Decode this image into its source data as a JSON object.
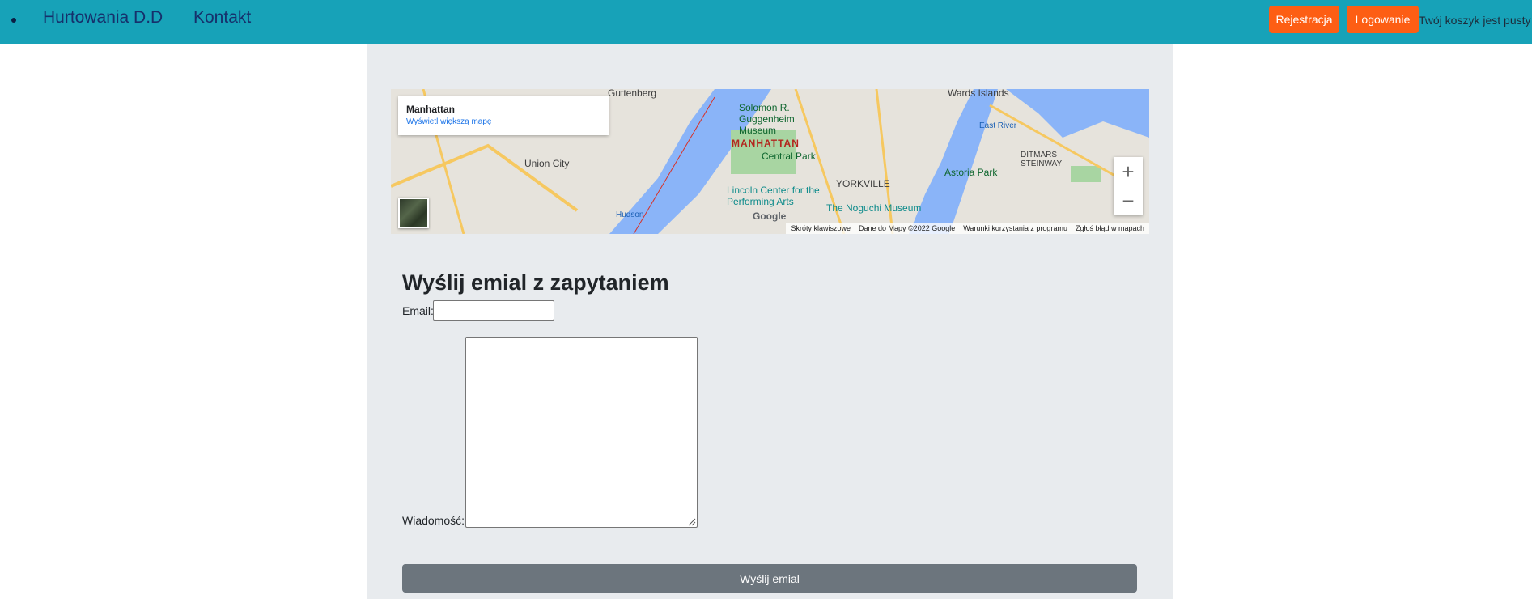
{
  "navbar": {
    "brand": "Hurtowania D.D",
    "contact": "Kontakt",
    "register_label": "Rejestracja",
    "login_label": "Logowanie",
    "cart_text": "Twój koszyk jest pusty"
  },
  "map": {
    "place_name": "Manhattan",
    "larger_map_link": "Wyświetl większą mapę",
    "zoom_in": "+",
    "zoom_out": "−",
    "labels": {
      "guttenberg": "Guttenberg",
      "union_city": "Union City",
      "manhattan": "MANHATTAN",
      "central_park": "Central Park",
      "guggenheim": "Solomon R. Guggenheim Museum",
      "lincoln": "Lincoln Center for the Performing Arts",
      "yorkville": "YORKVILLE",
      "noguchi": "The Noguchi Museum",
      "astoria_park": "Astoria Park",
      "ditmars": "DITMARS STEINWAY",
      "wards_island": "Wards Islands",
      "hudson": "Hudson",
      "east_river": "East River"
    },
    "attribution": {
      "shortcuts": "Skróty klawiszowe",
      "map_data": "Dane do Mapy ©2022 Google",
      "terms": "Warunki korzystania z programu",
      "report": "Zgłoś błąd w mapach"
    },
    "google_logo": "Google"
  },
  "form": {
    "title": "Wyślij emial z zapytaniem",
    "email_label": "Email:",
    "email_value": "",
    "message_label": "Wiadomość:",
    "message_value": "",
    "submit_label": "Wyślij emial"
  },
  "colors": {
    "navbar": "#17a2b8",
    "accent_button": "#fd5e14",
    "submit_button": "#6c757d",
    "content_bg": "#e8ebee"
  }
}
